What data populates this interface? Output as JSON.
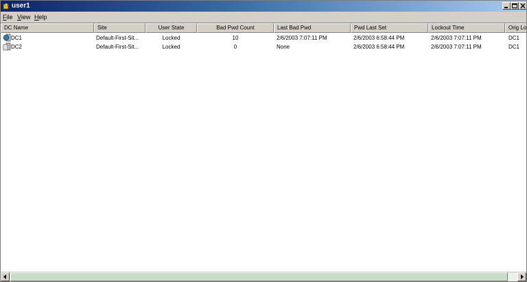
{
  "window": {
    "title": "user1"
  },
  "menu": [
    {
      "label_acc": "F",
      "label_rest": "ile"
    },
    {
      "label_acc": "V",
      "label_rest": "iew"
    },
    {
      "label_acc": "H",
      "label_rest": "elp"
    }
  ],
  "columns": [
    "DC Name",
    "Site",
    "User State",
    "Bad Pwd Count",
    "Last Bad Pwd",
    "Pwd Last Set",
    "Lockout Time",
    "Orig Lo"
  ],
  "rows": [
    {
      "dc_name": "DC1",
      "site": "Default-First-Sit...",
      "user_state": "Locked",
      "bad_pwd_count": "10",
      "last_bad_pwd": "2/6/2003 7:07:11 PM",
      "pwd_last_set": "2/6/2003 6:58:44 PM",
      "lockout_time": "2/6/2003 7:07:11 PM",
      "orig_lock": "DC1",
      "icon": "server-globe-icon"
    },
    {
      "dc_name": "DC2",
      "site": "Default-First-Sit...",
      "user_state": "Locked",
      "bad_pwd_count": "0",
      "last_bad_pwd": "None",
      "pwd_last_set": "2/6/2003 6:58:44 PM",
      "lockout_time": "2/6/2003 7:07:11 PM",
      "orig_lock": "DC1",
      "icon": "server-document-icon"
    }
  ],
  "colors": {
    "title_start": "#0a246a",
    "title_end": "#a6caf0",
    "chrome": "#d4d0c8"
  }
}
